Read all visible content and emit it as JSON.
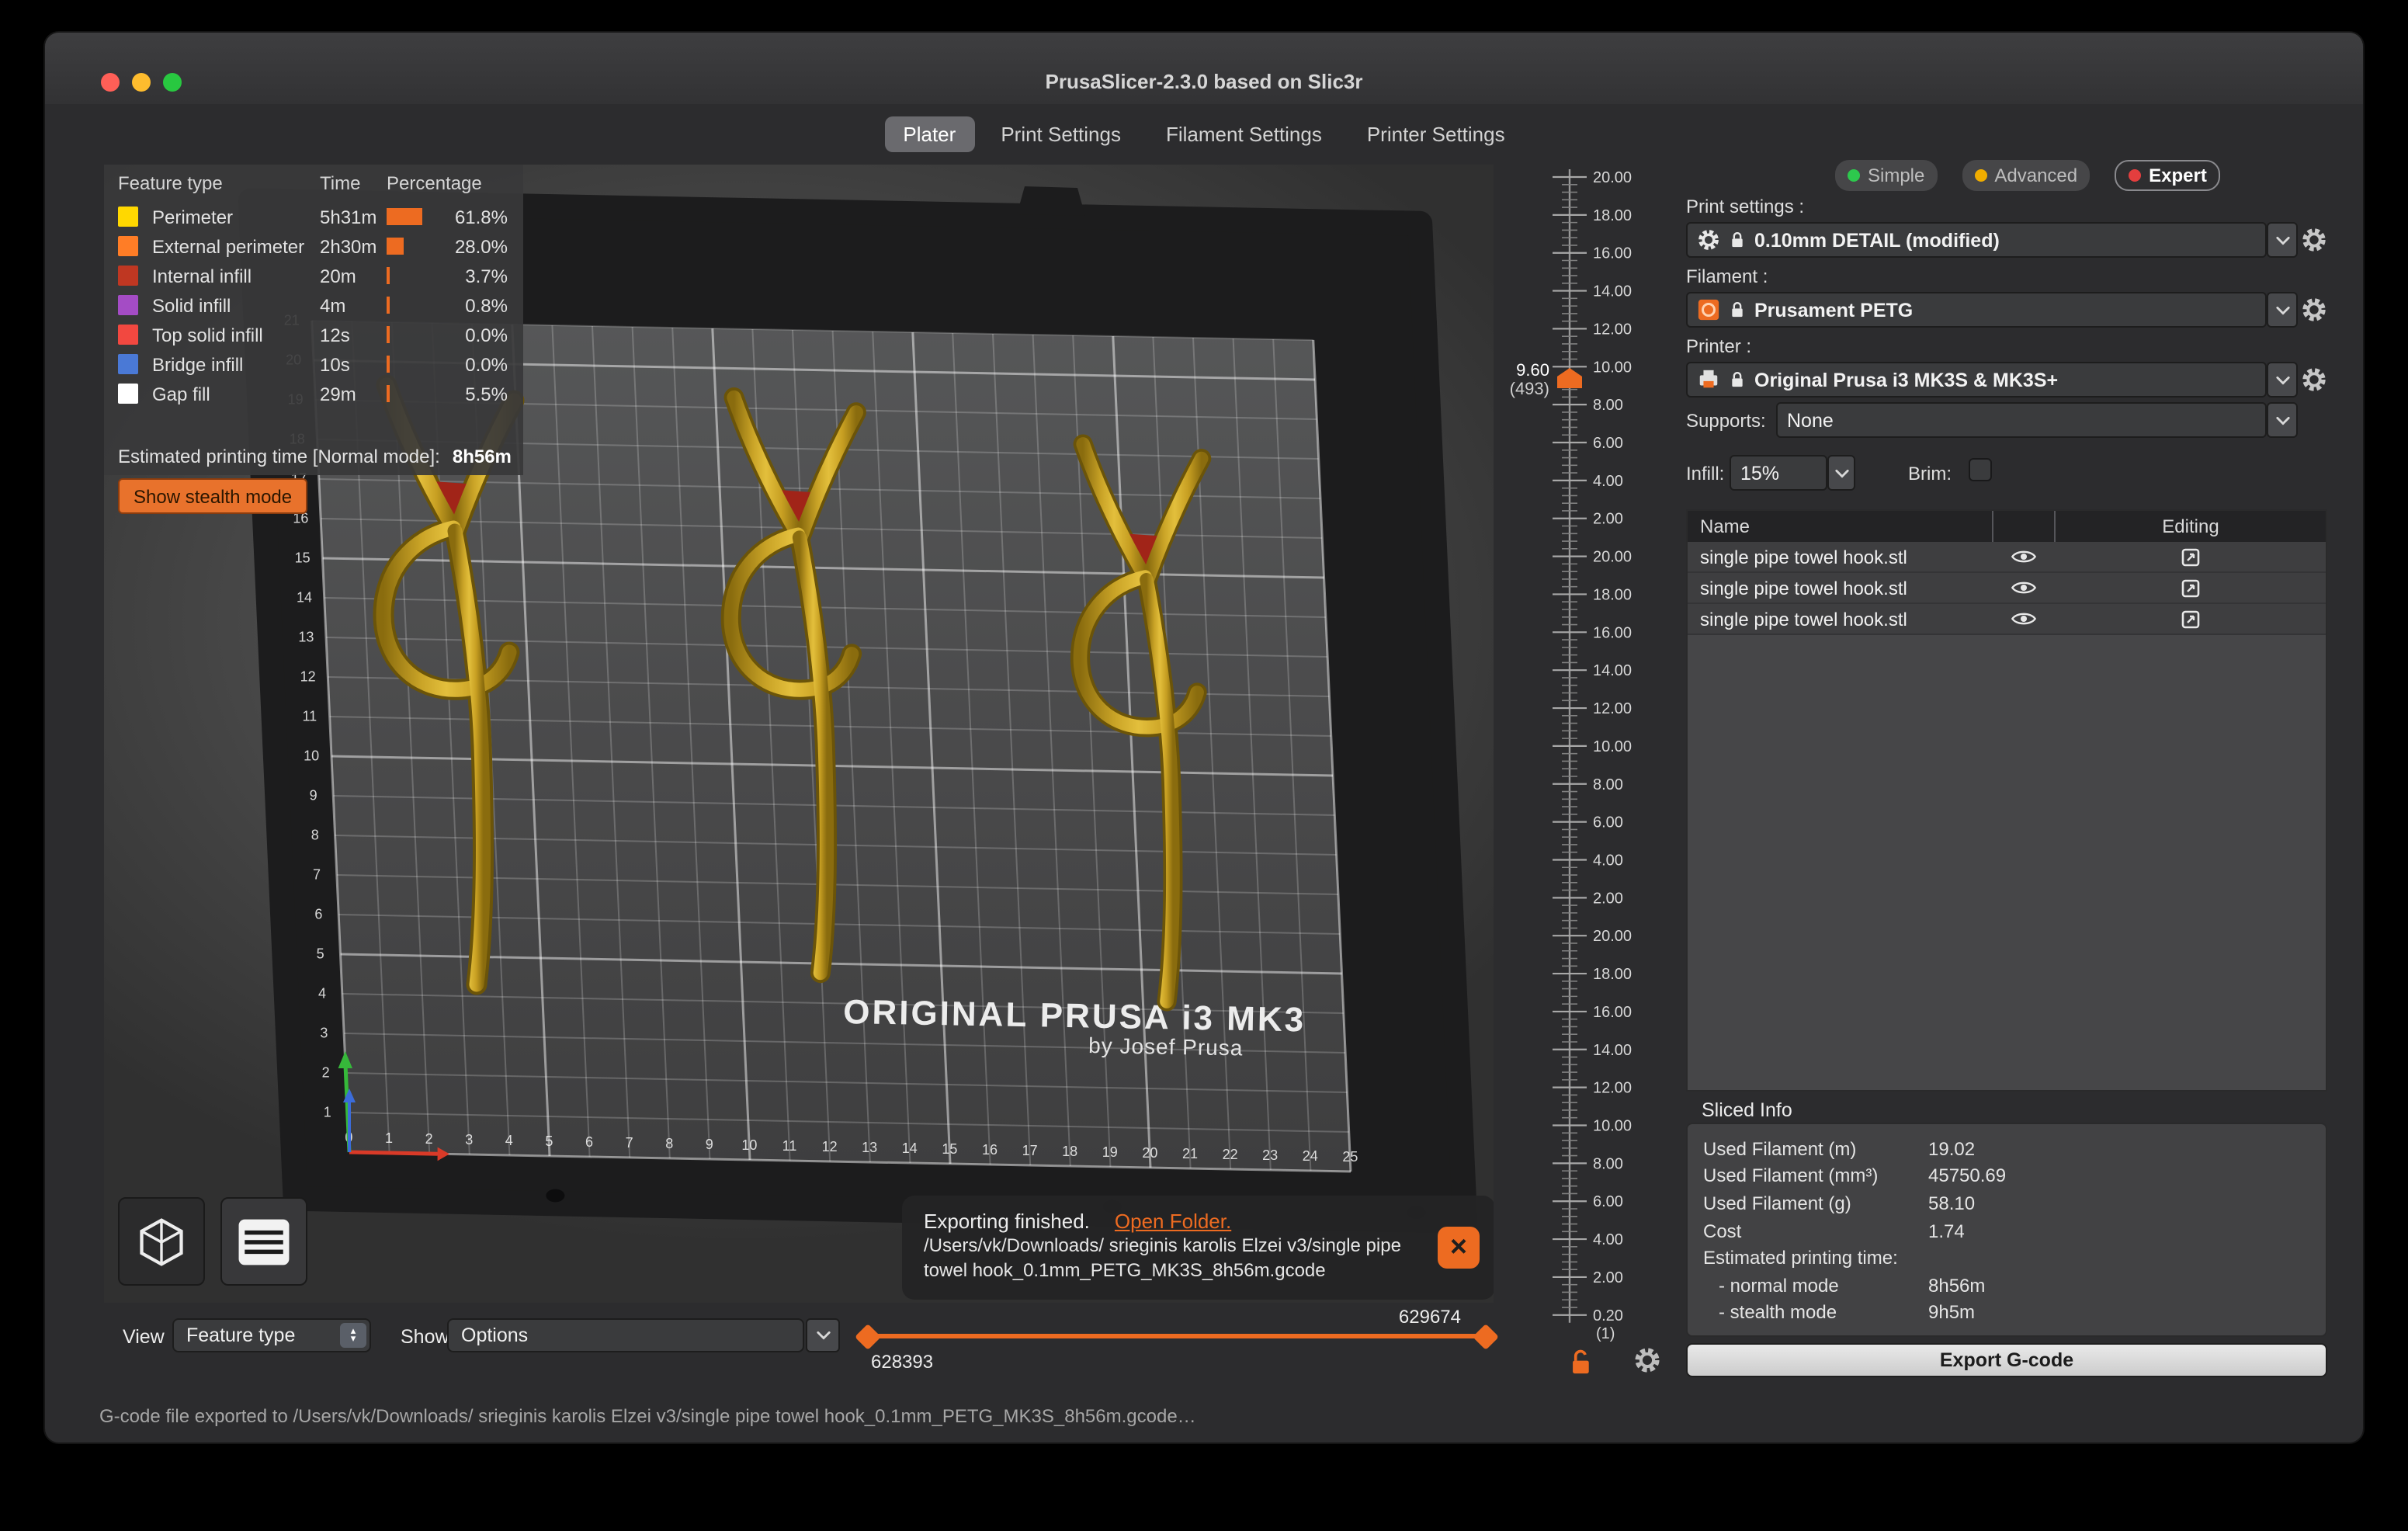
{
  "window": {
    "title": "PrusaSlicer-2.3.0 based on Slic3r"
  },
  "tabs": {
    "active": "Plater",
    "items": [
      {
        "label": "Plater"
      },
      {
        "label": "Print Settings"
      },
      {
        "label": "Filament Settings"
      },
      {
        "label": "Printer Settings"
      }
    ]
  },
  "legend": {
    "col_feature": "Feature type",
    "col_time": "Time",
    "col_percentage": "Percentage",
    "rows": [
      {
        "label": "Perimeter",
        "color": "#FFD800",
        "time": "5h31m",
        "pct": "61.8%",
        "pct_value": 61.8
      },
      {
        "label": "External perimeter",
        "color": "#FF7D26",
        "time": "2h30m",
        "pct": "28.0%",
        "pct_value": 28.0
      },
      {
        "label": "Internal infill",
        "color": "#BF3722",
        "time": "20m",
        "pct": "3.7%",
        "pct_value": 3.7
      },
      {
        "label": "Solid infill",
        "color": "#A44CC5",
        "time": "4m",
        "pct": "0.8%",
        "pct_value": 0.8
      },
      {
        "label": "Top solid infill",
        "color": "#F24840",
        "time": "12s",
        "pct": "0.0%",
        "pct_value": 0.0
      },
      {
        "label": "Bridge infill",
        "color": "#4A79D6",
        "time": "10s",
        "pct": "0.0%",
        "pct_value": 0.0
      },
      {
        "label": "Gap fill",
        "color": "#FFFFFF",
        "time": "29m",
        "pct": "5.5%",
        "pct_value": 5.5
      }
    ],
    "estimated_label": "Estimated printing time [Normal mode]:",
    "estimated_value": "8h56m",
    "stealth_button": "Show stealth mode"
  },
  "viewport": {
    "bed_brand": "ORIGINAL PRUSA i3 MK3",
    "bed_byline": "by Josef Prusa",
    "x_labels": [
      "0",
      "1",
      "2",
      "3",
      "4",
      "5",
      "6",
      "7",
      "8",
      "9",
      "10",
      "11",
      "12",
      "13",
      "14",
      "15",
      "16",
      "17",
      "18",
      "19",
      "20",
      "21",
      "22",
      "23",
      "24",
      "25"
    ],
    "y_labels": [
      "0",
      "1",
      "2",
      "3",
      "4",
      "5",
      "6",
      "7",
      "8",
      "9",
      "10",
      "11",
      "12",
      "13",
      "14",
      "15",
      "16",
      "17",
      "18",
      "19",
      "20",
      "21"
    ]
  },
  "notification": {
    "line1": "Exporting finished.",
    "link": "Open Folder.",
    "line2": "/Users/vk/Downloads/ srieginis karolis Elzei v3/single pipe",
    "line3": "towel hook_0.1mm_PETG_MK3S_8h56m.gcode"
  },
  "layer_slider": {
    "tick_labels": [
      "20.00",
      "18.00",
      "16.00",
      "14.00",
      "12.00",
      "10.00",
      "8.00",
      "6.00",
      "4.00",
      "2.00",
      "20.00",
      "18.00",
      "16.00",
      "14.00",
      "12.00",
      "10.00",
      "8.00",
      "6.00",
      "4.00",
      "2.00",
      "20.00",
      "18.00",
      "16.00",
      "14.00",
      "12.00",
      "10.00",
      "8.00",
      "6.00",
      "4.00",
      "2.00",
      "0.20"
    ],
    "bottom_layer": "(1)",
    "tooltip_value": "9.60",
    "tooltip_layer": "(493)"
  },
  "toolbar": {
    "view_label": "View",
    "view_value": "Feature type",
    "show_label": "Show",
    "show_value": "Options",
    "slider_min": "628393",
    "slider_max": "629674"
  },
  "panel": {
    "modes": [
      {
        "label": "Simple",
        "color": "#2dc84d"
      },
      {
        "label": "Advanced",
        "color": "#f0ad00"
      },
      {
        "label": "Expert",
        "color": "#e43e3e"
      }
    ],
    "active_mode": "Expert",
    "print_settings_label": "Print settings :",
    "print_settings_value": "0.10mm DETAIL (modified)",
    "filament_label": "Filament :",
    "filament_value": "Prusament PETG",
    "printer_label": "Printer :",
    "printer_value": "Original Prusa i3 MK3S & MK3S+",
    "supports_label": "Supports:",
    "supports_value": "None",
    "infill_label": "Infill:",
    "infill_value": "15%",
    "brim_label": "Brim:",
    "table": {
      "col_name": "Name",
      "col_editing": "Editing",
      "rows": [
        {
          "name": "single pipe towel hook.stl"
        },
        {
          "name": "single pipe towel hook.stl"
        },
        {
          "name": "single pipe towel hook.stl"
        }
      ]
    },
    "sliced_info": {
      "title": "Sliced Info",
      "rows": [
        {
          "label": "Used Filament (m)",
          "value": "19.02"
        },
        {
          "label": "Used Filament (mm³)",
          "value": "45750.69"
        },
        {
          "label": "Used Filament (g)",
          "value": "58.10"
        },
        {
          "label": "Cost",
          "value": "1.74"
        },
        {
          "label": "Estimated printing time:",
          "value": ""
        },
        {
          "label": "- normal mode",
          "value": "8h56m"
        },
        {
          "label": "- stealth mode",
          "value": "9h5m"
        }
      ]
    },
    "export_button": "Export G-code"
  },
  "status_bar": {
    "text": "G-code file exported to /Users/vk/Downloads/ srieginis karolis Elzei v3/single pipe towel hook_0.1mm_PETG_MK3S_8h56m.gcode…"
  },
  "colors": {
    "accent": "#ED6B21"
  }
}
